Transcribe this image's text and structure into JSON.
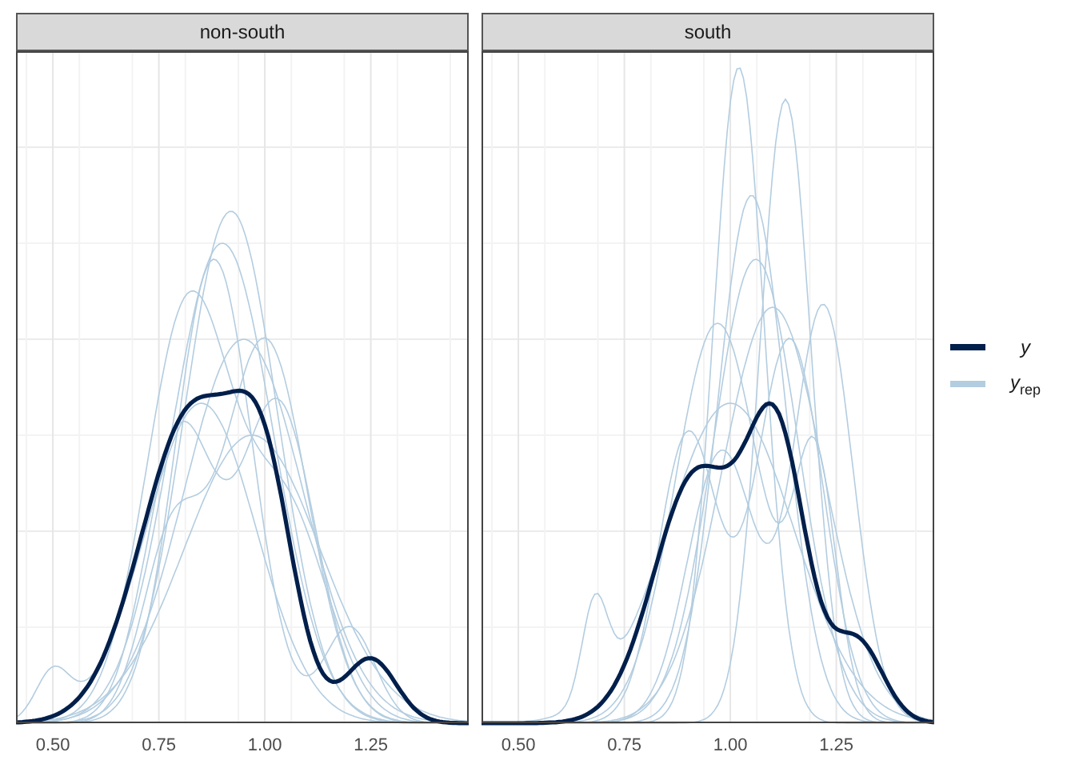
{
  "facets": [
    {
      "title": "non-south",
      "ticks": [
        "0.50",
        "0.75",
        "1.00",
        "1.25"
      ]
    },
    {
      "title": "south",
      "ticks": [
        "0.50",
        "0.75",
        "1.00",
        "1.25"
      ]
    }
  ],
  "legend": [
    {
      "label": "y",
      "kind": "observed"
    },
    {
      "label": "*y*$_{rep}$",
      "kind": "replicated"
    }
  ]
}
